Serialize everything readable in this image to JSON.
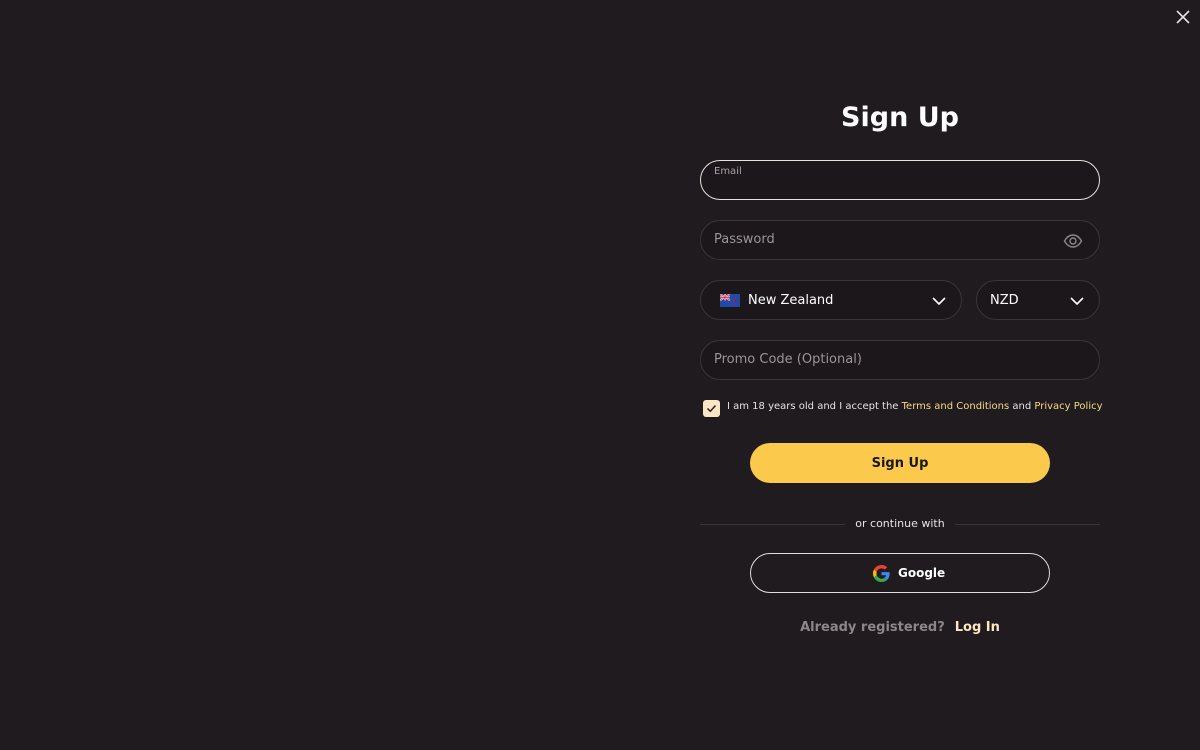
{
  "header": {
    "close_icon": "close-icon"
  },
  "form": {
    "title": "Sign Up",
    "email": {
      "label": "Email",
      "value": ""
    },
    "password": {
      "placeholder": "Password",
      "toggle_icon": "eye-icon"
    },
    "country": {
      "value": "New Zealand",
      "flag_icon": "new-zealand-flag-icon"
    },
    "currency": {
      "value": "NZD"
    },
    "promo": {
      "placeholder": "Promo Code (Optional)"
    },
    "terms": {
      "checked": true,
      "text_before": "I am 18 years old and I accept the ",
      "terms_link": "Terms and Conditions",
      "text_middle": " and ",
      "privacy_link": "Privacy Policy"
    },
    "submit_label": "Sign Up",
    "divider_text": "or continue with",
    "google_label": "Google",
    "already_registered": "Already registered?",
    "login_link": "Log In"
  },
  "colors": {
    "background": "#201b1e",
    "accent": "#fbc94b",
    "link": "#f6d78b"
  }
}
